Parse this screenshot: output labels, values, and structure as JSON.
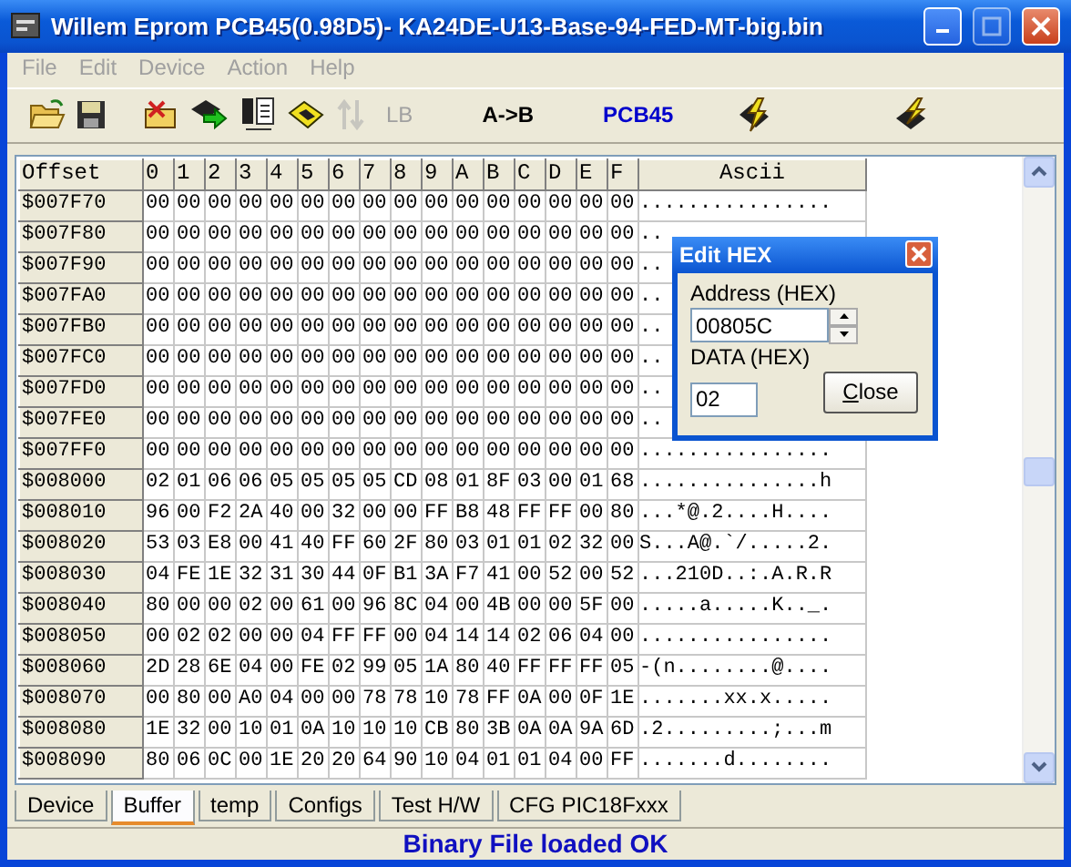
{
  "window": {
    "title": "Willem Eprom PCB45(0.98D5)- KA24DE-U13-Base-94-FED-MT-big.bin"
  },
  "menu": [
    {
      "label": "File",
      "disabled": true
    },
    {
      "label": "Edit",
      "disabled": true
    },
    {
      "label": "Device",
      "disabled": true
    },
    {
      "label": "Action",
      "disabled": true
    },
    {
      "label": "Help",
      "disabled": true
    }
  ],
  "toolbar": [
    {
      "kind": "open",
      "disabled": false
    },
    {
      "kind": "save",
      "disabled": false
    },
    {
      "kind": "erase",
      "disabled": false
    },
    {
      "kind": "program",
      "disabled": false
    },
    {
      "kind": "chipdoc",
      "disabled": false
    },
    {
      "kind": "chipyellow",
      "disabled": false
    },
    {
      "kind": "swap",
      "disabled": true
    },
    {
      "kind": "text",
      "label": "LB",
      "disabled": true,
      "color": "#a0a0a0"
    },
    {
      "kind": "text",
      "label": "A->B",
      "disabled": false,
      "color": "#000000"
    },
    {
      "kind": "text",
      "label": "PCB45",
      "disabled": false,
      "color": "#0000cc"
    },
    {
      "kind": "bolt",
      "disabled": false
    },
    {
      "kind": "bolt2",
      "disabled": false
    }
  ],
  "grid": {
    "columns": [
      "Offset",
      "0",
      "1",
      "2",
      "3",
      "4",
      "5",
      "6",
      "7",
      "8",
      "9",
      "A",
      "B",
      "C",
      "D",
      "E",
      "F",
      "Ascii"
    ],
    "rows": [
      [
        "$007F70",
        "00",
        "00",
        "00",
        "00",
        "00",
        "00",
        "00",
        "00",
        "00",
        "00",
        "00",
        "00",
        "00",
        "00",
        "00",
        "00",
        "................"
      ],
      [
        "$007F80",
        "00",
        "00",
        "00",
        "00",
        "00",
        "00",
        "00",
        "00",
        "00",
        "00",
        "00",
        "00",
        "00",
        "00",
        "00",
        "00",
        ".."
      ],
      [
        "$007F90",
        "00",
        "00",
        "00",
        "00",
        "00",
        "00",
        "00",
        "00",
        "00",
        "00",
        "00",
        "00",
        "00",
        "00",
        "00",
        "00",
        ".."
      ],
      [
        "$007FA0",
        "00",
        "00",
        "00",
        "00",
        "00",
        "00",
        "00",
        "00",
        "00",
        "00",
        "00",
        "00",
        "00",
        "00",
        "00",
        "00",
        ".."
      ],
      [
        "$007FB0",
        "00",
        "00",
        "00",
        "00",
        "00",
        "00",
        "00",
        "00",
        "00",
        "00",
        "00",
        "00",
        "00",
        "00",
        "00",
        "00",
        ".."
      ],
      [
        "$007FC0",
        "00",
        "00",
        "00",
        "00",
        "00",
        "00",
        "00",
        "00",
        "00",
        "00",
        "00",
        "00",
        "00",
        "00",
        "00",
        "00",
        ".."
      ],
      [
        "$007FD0",
        "00",
        "00",
        "00",
        "00",
        "00",
        "00",
        "00",
        "00",
        "00",
        "00",
        "00",
        "00",
        "00",
        "00",
        "00",
        "00",
        ".."
      ],
      [
        "$007FE0",
        "00",
        "00",
        "00",
        "00",
        "00",
        "00",
        "00",
        "00",
        "00",
        "00",
        "00",
        "00",
        "00",
        "00",
        "00",
        "00",
        ".."
      ],
      [
        "$007FF0",
        "00",
        "00",
        "00",
        "00",
        "00",
        "00",
        "00",
        "00",
        "00",
        "00",
        "00",
        "00",
        "00",
        "00",
        "00",
        "00",
        "................"
      ],
      [
        "$008000",
        "02",
        "01",
        "06",
        "06",
        "05",
        "05",
        "05",
        "05",
        "CD",
        "08",
        "01",
        "8F",
        "03",
        "00",
        "01",
        "68",
        "...............h"
      ],
      [
        "$008010",
        "96",
        "00",
        "F2",
        "2A",
        "40",
        "00",
        "32",
        "00",
        "00",
        "FF",
        "B8",
        "48",
        "FF",
        "FF",
        "00",
        "80",
        "...*@.2....H...."
      ],
      [
        "$008020",
        "53",
        "03",
        "E8",
        "00",
        "41",
        "40",
        "FF",
        "60",
        "2F",
        "80",
        "03",
        "01",
        "01",
        "02",
        "32",
        "00",
        "S...A@.`/.....2."
      ],
      [
        "$008030",
        "04",
        "FE",
        "1E",
        "32",
        "31",
        "30",
        "44",
        "0F",
        "B1",
        "3A",
        "F7",
        "41",
        "00",
        "52",
        "00",
        "52",
        "...210D..:.A.R.R"
      ],
      [
        "$008040",
        "80",
        "00",
        "00",
        "02",
        "00",
        "61",
        "00",
        "96",
        "8C",
        "04",
        "00",
        "4B",
        "00",
        "00",
        "5F",
        "00",
        ".....a.....K.._."
      ],
      [
        "$008050",
        "00",
        "02",
        "02",
        "00",
        "00",
        "04",
        "FF",
        "FF",
        "00",
        "04",
        "14",
        "14",
        "02",
        "06",
        "04",
        "00",
        "................"
      ],
      [
        "$008060",
        "2D",
        "28",
        "6E",
        "04",
        "00",
        "FE",
        "02",
        "99",
        "05",
        "1A",
        "80",
        "40",
        "FF",
        "FF",
        "FF",
        "05",
        "-(n........@...."
      ],
      [
        "$008070",
        "00",
        "80",
        "00",
        "A0",
        "04",
        "00",
        "00",
        "78",
        "78",
        "10",
        "78",
        "FF",
        "0A",
        "00",
        "0F",
        "1E",
        ".......xx.x....."
      ],
      [
        "$008080",
        "1E",
        "32",
        "00",
        "10",
        "01",
        "0A",
        "10",
        "10",
        "10",
        "CB",
        "80",
        "3B",
        "0A",
        "0A",
        "9A",
        "6D",
        ".2.........;...m"
      ],
      [
        "$008090",
        "80",
        "06",
        "0C",
        "00",
        "1E",
        "20",
        "20",
        "64",
        "90",
        "10",
        "04",
        "01",
        "01",
        "04",
        "00",
        "FF",
        ".......d........"
      ]
    ]
  },
  "dialog": {
    "title": "Edit HEX",
    "address_label": "Address (HEX)",
    "address_value": "00805C",
    "data_label": "DATA (HEX)",
    "data_value": "02",
    "close_button": "Close"
  },
  "tabs": [
    {
      "label": "Device",
      "selected": false
    },
    {
      "label": "Buffer",
      "selected": true
    },
    {
      "label": "temp",
      "selected": false
    },
    {
      "label": "Configs",
      "selected": false
    },
    {
      "label": "Test H/W",
      "selected": false
    },
    {
      "label": "CFG PIC18Fxxx",
      "selected": false
    }
  ],
  "status_bar": "Binary File loaded OK"
}
